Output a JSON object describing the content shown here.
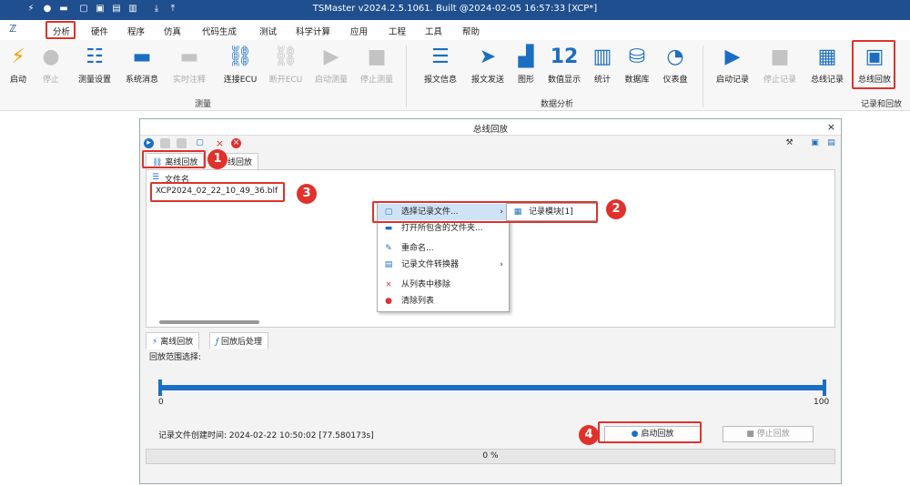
{
  "window": {
    "title": "TSMaster v2024.2.5.1061. Built @2024-02-05 16:57:33 [XCP*]"
  },
  "menu": [
    "分析",
    "硬件",
    "程序",
    "仿真",
    "代码生成",
    "测试",
    "科学计算",
    "应用",
    "工程",
    "工具",
    "帮助"
  ],
  "ribbon": {
    "measure": {
      "label": "测量",
      "buttons": [
        "启动",
        "停止",
        "测量设置",
        "系统消息",
        "实时注释",
        "连接ECU",
        "断开ECU",
        "启动测量",
        "停止测量"
      ]
    },
    "analysis": {
      "label": "数据分析",
      "buttons": [
        "报文信息",
        "报文发送",
        "图形",
        "数值显示",
        "统计",
        "数据库",
        "仪表盘"
      ],
      "num_icon": "12"
    },
    "record": {
      "label": "记录和回放",
      "buttons": [
        "启动记录",
        "停止记录",
        "总线记录",
        "总线回放"
      ]
    }
  },
  "dialog": {
    "title": "总线回放",
    "top_tabs": [
      "离线回放",
      "线回放"
    ],
    "file_header": "文件名",
    "file": "XCP2024_02_22_10_49_36.blf",
    "context_menu": [
      "选择记录文件...",
      "打开所包含的文件夹...",
      "重命名...",
      "记录文件转换器",
      "从列表中移除",
      "清除列表"
    ],
    "submenu": "记录模块[1]",
    "bottom_tabs": [
      "离线回放",
      "回放后处理"
    ],
    "range_label": "回放范围选择:",
    "range_min": "0",
    "range_max": "100",
    "created": "记录文件创建时间: 2024-02-22 10:50:02 [77.580173s]",
    "start_btn": "启动回放",
    "stop_btn": "停止回放",
    "progress": "0 %"
  },
  "badges": [
    "1",
    "2",
    "3",
    "4"
  ]
}
